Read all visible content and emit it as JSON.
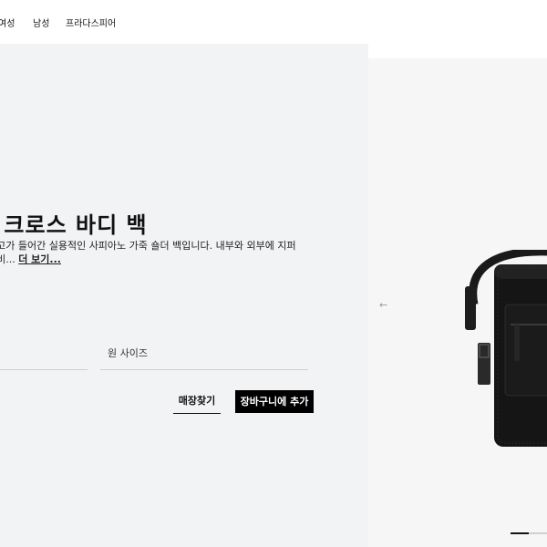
{
  "nav": {
    "items": [
      "여성",
      "남성",
      "프라다스피어"
    ]
  },
  "product": {
    "title": "죽 크로스 바디 백",
    "description": "로고가 들어간 실용적인 사피아노 가죽 숄더 백입니다. 내부와 외부에 지퍼 대비...",
    "description_line1": "로고가 들어간 실용적인 사피아노 가죽 숄더 백입니다. 내부와 외부에 지퍼",
    "description_line2_prefix": "대비...",
    "more_link": "더 보기..."
  },
  "size_selector": {
    "value": "원 사이즈"
  },
  "actions": {
    "find_store": "매장찾기",
    "add_to_cart": "장바구니에 추가"
  },
  "gallery": {
    "prev_arrow": "←",
    "image": "black leather crossbody bag",
    "pager": {
      "current": 1
    }
  },
  "colors": {
    "panel_bg": "#f2f3f5",
    "button_bg": "#000000",
    "gallery_bg": "#f6f6f6"
  }
}
